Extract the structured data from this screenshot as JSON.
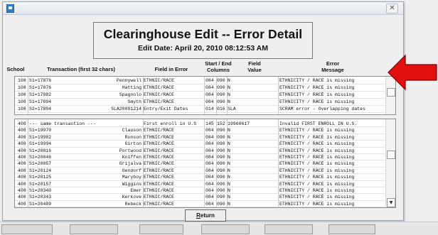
{
  "window": {
    "close_glyph": "✕"
  },
  "header": {
    "title": "Clearinghouse Edit  --  Error Detail",
    "edit_date": "Edit Date:  April 20, 2010   08:12:53 AM"
  },
  "columns": {
    "school": "School",
    "transaction": "Transaction  (first 32 chars)",
    "field_in_error": "Field in Error",
    "start_end_1": "Start / End",
    "start_end_2": "Columns",
    "field_value_1": "Field",
    "field_value_2": "Value",
    "error_1": "Error",
    "error_2": "Message"
  },
  "upper_rows": [
    {
      "school": "108",
      "trans": "S1=17876",
      "name": "Pennywell",
      "field": "ETHNIC/RACE",
      "start": "084",
      "end": "090",
      "value": "N",
      "message": "ETHNICITY / RACE is missing"
    },
    {
      "school": "108",
      "trans": "S1=17876",
      "name": "Hatting",
      "field": "ETHNIC/RACE",
      "start": "084",
      "end": "090",
      "value": "N",
      "message": "ETHNICITY / RACE is missing"
    },
    {
      "school": "108",
      "trans": "S1=17882",
      "name": "Spagnolo",
      "field": "ETHNIC/RACE",
      "start": "084",
      "end": "090",
      "value": "N",
      "message": "ETHNICITY / RACE is missing"
    },
    {
      "school": "108",
      "trans": "S1=17894",
      "name": "Smyth",
      "field": "ETHNIC/RACE",
      "start": "084",
      "end": "090",
      "value": "N",
      "message": "ETHNICITY / RACE is missing"
    },
    {
      "school": "108",
      "trans": "S2=17894",
      "name": "SLA20091214",
      "field": "Entry/Exit Dates",
      "start": "014",
      "end": "016",
      "value": "SLA",
      "message": "SCRAM error - Overlapping dates"
    }
  ],
  "lower_rows": [
    {
      "school": "408",
      "trans": "--- same transaction ---",
      "name": "",
      "field": "First enroll in U.S",
      "start": "145",
      "end": "152",
      "value": "19960617",
      "message": "Invalid FIRST ENROLL IN U.S."
    },
    {
      "school": "408",
      "trans": "S1=19970",
      "name": "Clauson",
      "field": "ETHNIC/RACE",
      "start": "084",
      "end": "090",
      "value": "N",
      "message": "ETHNICITY / RACE is missing"
    },
    {
      "school": "408",
      "trans": "S1=19982",
      "name": "Ronson",
      "field": "ETHNIC/RACE",
      "start": "084",
      "end": "090",
      "value": "N",
      "message": "ETHNICITY / RACE is missing"
    },
    {
      "school": "408",
      "trans": "S1=19994",
      "name": "Girton",
      "field": "ETHNIC/RACE",
      "start": "084",
      "end": "090",
      "value": "N",
      "message": "ETHNICITY / RACE is missing"
    },
    {
      "school": "408",
      "trans": "S1=20016",
      "name": "Portwood",
      "field": "ETHNIC/RACE",
      "start": "084",
      "end": "090",
      "value": "N",
      "message": "ETHNICITY / RACE is missing"
    },
    {
      "school": "408",
      "trans": "S1=20046",
      "name": "Kniffen",
      "field": "ETHNIC/RACE",
      "start": "084",
      "end": "090",
      "value": "N",
      "message": "ETHNICITY / RACE is missing"
    },
    {
      "school": "408",
      "trans": "S1=20057",
      "name": "Grijalva",
      "field": "ETHNIC/RACE",
      "start": "084",
      "end": "090",
      "value": "N",
      "message": "ETHNICITY / RACE is missing"
    },
    {
      "school": "408",
      "trans": "S1=20124",
      "name": "Gendorf",
      "field": "ETHNIC/RACE",
      "start": "084",
      "end": "090",
      "value": "N",
      "message": "ETHNICITY / RACE is missing"
    },
    {
      "school": "408",
      "trans": "S1=20125",
      "name": "Maryboy",
      "field": "ETHNIC/RACE",
      "start": "084",
      "end": "090",
      "value": "N",
      "message": "ETHNICITY / RACE is missing"
    },
    {
      "school": "408",
      "trans": "S1=20157",
      "name": "Wiggins",
      "field": "ETHNIC/RACE",
      "start": "084",
      "end": "090",
      "value": "N",
      "message": "ETHNICITY / RACE is missing"
    },
    {
      "school": "408",
      "trans": "S1=20340",
      "name": "Emer",
      "field": "ETHNIC/RACE",
      "start": "084",
      "end": "090",
      "value": "N",
      "message": "ETHNICITY / RACE is missing"
    },
    {
      "school": "408",
      "trans": "S1=20343",
      "name": "Kerkove",
      "field": "ETHNIC/RACE",
      "start": "084",
      "end": "090",
      "value": "N",
      "message": "ETHNICITY / RACE is missing"
    },
    {
      "school": "408",
      "trans": "S1=20489",
      "name": "Rebeck",
      "field": "ETHNIC/RACE",
      "start": "084",
      "end": "090",
      "value": "N",
      "message": "ETHNICITY / RACE is missing"
    }
  ],
  "footer": {
    "return_accel": "R",
    "return_rest": "eturn"
  },
  "scroll_down_glyph": "▼",
  "annotation": {
    "arrow_color": "#e01010",
    "arrow_outline": "#7a0000",
    "icon": "arrow-left-icon"
  }
}
